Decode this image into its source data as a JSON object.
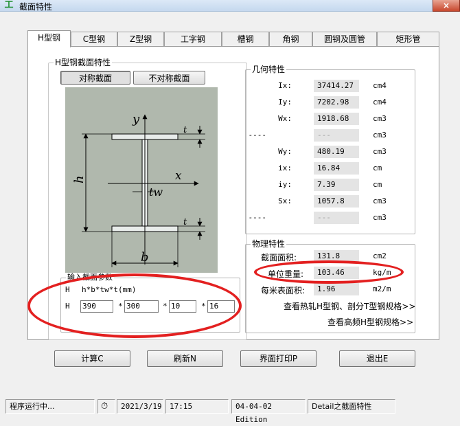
{
  "window": {
    "title": "截面特性",
    "close_glyph": "×"
  },
  "tabs": [
    {
      "label": "H型钢",
      "active": true
    },
    {
      "label": "C型钢"
    },
    {
      "label": "Z型钢"
    },
    {
      "label": "工字钢"
    },
    {
      "label": "槽钢"
    },
    {
      "label": "角钢"
    },
    {
      "label": "圆钢及圆管"
    },
    {
      "label": "矩形管"
    }
  ],
  "section_group": {
    "title": "H型钢截面特性",
    "symmetric_button": "对称截面",
    "asymmetric_button": "不对称截面"
  },
  "diagram": {
    "y_label": "y",
    "x_label": "x",
    "h_label": "h",
    "b_label": "b",
    "tw_label": "tw",
    "t_top_label": "t",
    "t_bottom_label": "t"
  },
  "input_group": {
    "title": "输入截面参数",
    "format_prefix": "H",
    "format_text": "h*b*tw*t(mm)",
    "row_prefix": "H",
    "star": "*",
    "h_value": "390",
    "b_value": "300",
    "tw_value": "10",
    "t_value": "16"
  },
  "geometry_group": {
    "title": "几何特性",
    "rows": [
      {
        "label": "Ix:",
        "value": "37414.27",
        "unit": "cm4"
      },
      {
        "label": "Iy:",
        "value": "7202.98",
        "unit": "cm4"
      },
      {
        "label": "Wx:",
        "value": "1918.68",
        "unit": "cm3"
      },
      {
        "label": "----",
        "value": "---",
        "unit": "cm3"
      },
      {
        "label": "Wy:",
        "value": "480.19",
        "unit": "cm3"
      },
      {
        "label": "ix:",
        "value": "16.84",
        "unit": "cm"
      },
      {
        "label": "iy:",
        "value": "7.39",
        "unit": "cm"
      },
      {
        "label": "Sx:",
        "value": "1057.8",
        "unit": "cm3"
      },
      {
        "label": "----",
        "value": "---",
        "unit": "cm3"
      }
    ]
  },
  "physical_group": {
    "title": "物理特性",
    "area_label": "截面面积:",
    "area_value": "131.8",
    "area_unit": "cm2",
    "weight_label": "单位重量:",
    "weight_value": "103.46",
    "weight_unit": "kg/m",
    "surface_label": "每米表面积:",
    "surface_value": "1.96",
    "surface_unit": "m2/m",
    "link_hot_rolled": "查看热轧H型钢、剖分T型钢规格>>",
    "link_high_freq": "查看高频H型钢规格>>"
  },
  "buttons": {
    "calculate": "计算C",
    "refresh": "刷新N",
    "print": "界面打印P",
    "exit": "退出E"
  },
  "status": {
    "running": "程序运行中...",
    "clock_icon": "⏱",
    "date": "2021/3/19",
    "time": "17:15",
    "edition": "04-04-02 Edition",
    "detail": "Detail之截面特性"
  },
  "colors": {
    "annotation_red": "#e32020",
    "diagram_bg": "#b0b8ad"
  }
}
